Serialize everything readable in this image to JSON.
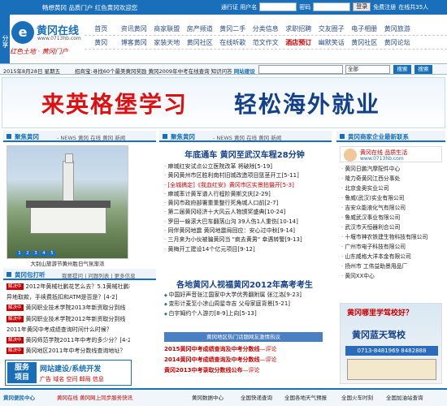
{
  "topbar": {
    "slogan": "畅想黄冈  品质门户  红色黄冈欢迎您",
    "user_label": "通行证 用户名",
    "pass_label": "密码",
    "login_button": "登录",
    "register_link": "免费注册",
    "online": "在线共35人"
  },
  "share_tab": "分享",
  "logo": {
    "mark": "e",
    "name": "黄冈在线",
    "url": "www.0713hb.com"
  },
  "motto": "红色土地 · 黄冈门户",
  "nav": {
    "row1": [
      "首页",
      "资讯黄冈",
      "商家联盟",
      "房产频道",
      "黄冈二手",
      "分类信息",
      "求职招聘",
      "交友圈子",
      "电子相册",
      "黄冈旅游"
    ],
    "row2": [
      "黄冈",
      "博客黄冈",
      "家装天地",
      "黄冈社区",
      "在线听歌",
      "范文作文",
      "酒店预订",
      "幽默笑话",
      "黄冈社区",
      "黄冈论坛"
    ],
    "red_index": 6
  },
  "datebar": {
    "date": "2015年8月28日 星期五",
    "ticker_label": "招聘",
    "ticker": "招商宝:寻找60个最美黄冈奖励  黄冈2009年中考在线查询  知识问答",
    "ticker_bold": "网站建设",
    "select_value": "全部",
    "search_button": "搜索",
    "search_button2": "搜索"
  },
  "banner": {
    "left": "来英格堡学习",
    "right": "轻松海外就业"
  },
  "left": {
    "section_title": "聚焦黄冈",
    "section_tabs": "- NEWS  黄冈  在线  黄冈  新闻",
    "caption": "大别山旅游节黄州胜日气氛渐浓",
    "dots": [
      "1",
      "2",
      "3",
      "4",
      "5"
    ],
    "bg_title": "黄冈包打听",
    "bg_tabs": "我要提问 | 问题列表 | 更多信息",
    "bg_items": [
      {
        "badge": "解决中",
        "text": "2012年黄械社鹏花艺么去？5.1黄械社鹏花"
      },
      {
        "badge": "",
        "text": "异地取款，手续费抵扣和ATM是否是？[4-2]"
      },
      {
        "badge": "解决中",
        "text": "黄冈职业技术学院2013年新资取分到线"
      },
      {
        "badge": "解决中",
        "text": "黄冈职业技术学院2012年新资取分到线"
      },
      {
        "badge": "",
        "text": "2011年黄冈中考成绩查询时间什么时候？"
      },
      {
        "badge": "解决中",
        "text": "黄冈师范学院2011年中考的多少分？[4-2]"
      },
      {
        "badge": "解决中",
        "text": "黄冈地区2011年中考分数线查询地址？"
      }
    ],
    "service": {
      "label1": "服务",
      "label2": "项目",
      "line1": "网站建设/系统开发",
      "line2": "广告 域名 空间 邮局 信息"
    }
  },
  "center": {
    "section_title": "聚焦黄冈",
    "section_tabs": "- NEWS  黄冈  在线  黄冈  新闻",
    "headline1": "年底通车  黄冈至武汉车程28分钟",
    "news1": [
      "麻城红安试点公立医院改革 将破除[5-19]",
      "黄冈黄州市区胜利南村旧城改造项目篮茎开工[5-11]",
      "[全城搞定]《我血红安》黄冈市区实景拍摄开[5-3]",
      "麻城率计黄军谱人行程阶黄斯文庆[2-29]",
      "黄冈市政府部署重重整行死角城人口前[2-7]",
      "第二届黄冈经济十大风云人物颁奖盛典[10-24]",
      "罗田一躲滚大巴车翻落山沟 39人伤1人重伤[10-14]",
      "同伴黄冈地震 黄冈地震局回应：安心过中秋[9-14]",
      "三月来为小伙被骗黄冈当 \"疯去黄男\" 幸遇转警[9-13]",
      "黄梅开工建设14个亿元项目[9-12]"
    ],
    "headline2": "各地黄冈人视福黄冈2012年高考考生",
    "news2": [
      "中国好声音张江国家中大学优秀翻附属 张江洛[9-23]",
      "变形计麦至小凉山周星寺吉 父母家庭背景[5-21]",
      "白宇姆约个人游刃[8-9]上向[5-13]"
    ],
    "hot_bar": "黄冈地区热门话题网友激情热议",
    "red_lines": [
      {
        "text": "2015黄冈中考成绩查询及中考分数线",
        "tail": "—评论"
      },
      {
        "text": "2014黄冈中考成绩查询及中考分数线",
        "tail": "—评论"
      },
      {
        "text": "黄冈2013中考录取分数线公布",
        "tail": "—评论"
      }
    ]
  },
  "right": {
    "section_title": "黄冈商家企业最新联系",
    "ad1_name": "黄冈在线 品质生活",
    "ad1_url": "www.0713hb.com",
    "companies": [
      "黄冈日鹏汽摩配件中心",
      "隆力奇黄冈江西分事处",
      "北京金奥实业公司",
      "鲁威(武汉)实业有限公司",
      "吉安众能液化气有限公司",
      "鲁威武汉事业有限公司",
      "武汉市天恒器利合公司",
      "十堰市神农铁建生物科技有限公司",
      "广州市电子科技有限公司",
      "山东威格大洋本金有限公司",
      "扬州市 工伟益助景用品厂",
      "黄冈XX中心"
    ],
    "ad2_question": "黄冈哪里学驾校好？",
    "ad2_school": "黄冈蓝天驾校",
    "ad2_tel": "0713-8481969  8482888"
  },
  "footer": {
    "f1": "黄冈便民中心",
    "f2": "黄冈在线 黄冈网上同步服务快讯",
    "f3": "黄冈数据中心",
    "f4": "全国快递查询",
    "f5": "全国各地天气预报",
    "f6": "全国火车时刻",
    "f7": "全国加油站查询"
  },
  "colors": {
    "primary": "#1a6fba",
    "accent": "#c00000",
    "dark": "#12408a"
  }
}
